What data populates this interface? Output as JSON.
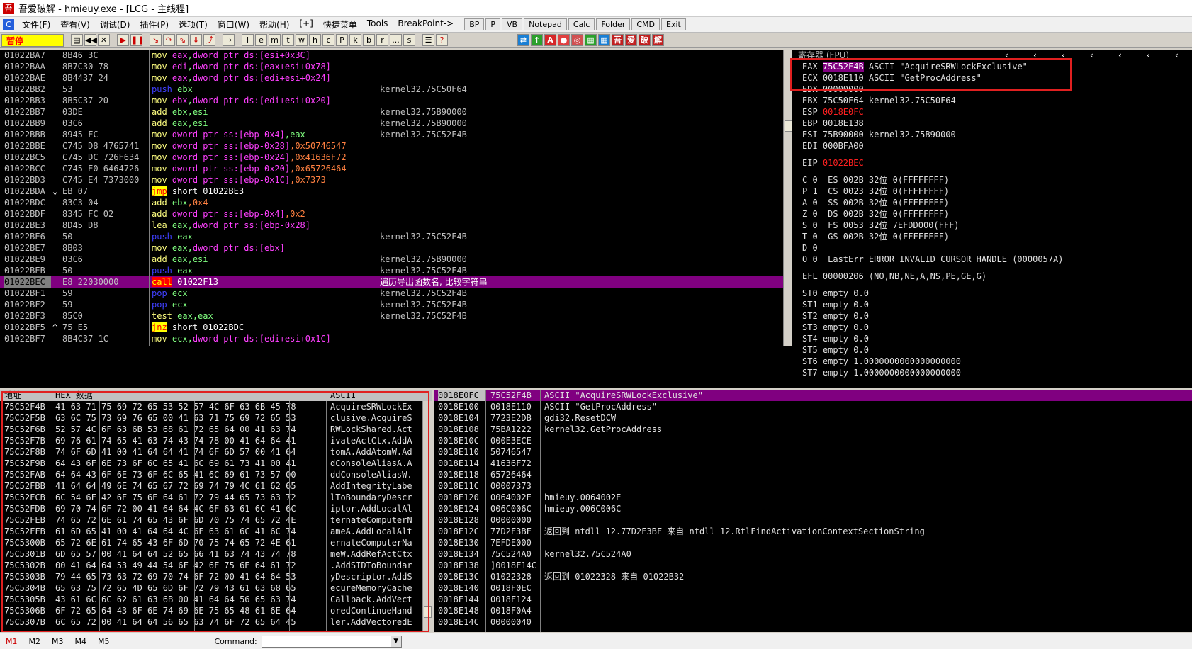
{
  "window": {
    "title": "吾爱破解 - hmieuy.exe - [LCG - 主线程]"
  },
  "menu": {
    "items": [
      "文件(F)",
      "查看(V)",
      "调试(D)",
      "插件(P)",
      "选项(T)",
      "窗口(W)",
      "帮助(H)",
      "[+]",
      "快捷菜单",
      "Tools",
      "BreakPoint->"
    ],
    "buttons": [
      "BP",
      "P",
      "VB",
      "Notepad",
      "Calc",
      "Folder",
      "CMD",
      "Exit"
    ]
  },
  "toolbar": {
    "status": "暂停",
    "letters": [
      "l",
      "e",
      "m",
      "t",
      "w",
      "h",
      "c",
      "P",
      "k",
      "b",
      "r",
      "...",
      "s"
    ]
  },
  "disasm": {
    "selected_index": 20,
    "rows": [
      {
        "addr": "01022BA7",
        "mark": "",
        "hex": "8B46 3C",
        "op": "mov",
        "args": [
          [
            "reg",
            "eax"
          ],
          [
            "",
            ","
          ],
          [
            "reg",
            "dword ptr ds:[esi+0x3C]"
          ]
        ],
        "cmt": ""
      },
      {
        "addr": "01022BAA",
        "mark": "",
        "hex": "8B7C30 78",
        "op": "mov",
        "args": [
          [
            "reg",
            "edi"
          ],
          [
            "",
            ","
          ],
          [
            "reg",
            "dword ptr ds:[eax+esi+0x78]"
          ]
        ],
        "cmt": ""
      },
      {
        "addr": "01022BAE",
        "mark": "",
        "hex": "8B4437 24",
        "op": "mov",
        "args": [
          [
            "reg",
            "eax"
          ],
          [
            "",
            ","
          ],
          [
            "reg",
            "dword ptr ds:[edi+esi+0x24]"
          ]
        ],
        "cmt": ""
      },
      {
        "addr": "01022BB2",
        "mark": "",
        "hex": "53",
        "op": "push",
        "args": [
          [
            "green",
            "ebx"
          ]
        ],
        "cmt": "kernel32.75C50F64"
      },
      {
        "addr": "01022BB3",
        "mark": "",
        "hex": "8B5C37 20",
        "op": "mov",
        "args": [
          [
            "reg",
            "ebx"
          ],
          [
            "",
            ","
          ],
          [
            "reg",
            "dword ptr ds:[edi+esi+0x20]"
          ]
        ],
        "cmt": ""
      },
      {
        "addr": "01022BB7",
        "mark": "",
        "hex": "03DE",
        "op": "add",
        "args": [
          [
            "green",
            "ebx,esi"
          ]
        ],
        "cmt": "kernel32.75B90000"
      },
      {
        "addr": "01022BB9",
        "mark": "",
        "hex": "03C6",
        "op": "add",
        "args": [
          [
            "green",
            "eax,esi"
          ]
        ],
        "cmt": "kernel32.75B90000"
      },
      {
        "addr": "01022BBB",
        "mark": "",
        "hex": "8945 FC",
        "op": "mov",
        "args": [
          [
            "reg",
            "dword ptr ss:[ebp-0x4]"
          ],
          [
            "green",
            ",eax"
          ]
        ],
        "cmt": "kernel32.75C52F4B"
      },
      {
        "addr": "01022BBE",
        "mark": "",
        "hex": "C745 D8 4765741",
        "op": "mov",
        "args": [
          [
            "reg",
            "dword ptr ss:[ebp-0x28]"
          ],
          [
            "imm",
            ",0x50746547"
          ]
        ],
        "cmt": ""
      },
      {
        "addr": "01022BC5",
        "mark": "",
        "hex": "C745 DC 726F634",
        "op": "mov",
        "args": [
          [
            "reg",
            "dword ptr ss:[ebp-0x24]"
          ],
          [
            "imm",
            ",0x41636F72"
          ]
        ],
        "cmt": ""
      },
      {
        "addr": "01022BCC",
        "mark": "",
        "hex": "C745 E0 6464726",
        "op": "mov",
        "args": [
          [
            "reg",
            "dword ptr ss:[ebp-0x20]"
          ],
          [
            "imm",
            ",0x65726464"
          ]
        ],
        "cmt": ""
      },
      {
        "addr": "01022BD3",
        "mark": "",
        "hex": "C745 E4 7373000",
        "op": "mov",
        "args": [
          [
            "reg",
            "dword ptr ss:[ebp-0x1C]"
          ],
          [
            "imm",
            ",0x7373"
          ]
        ],
        "cmt": ""
      },
      {
        "addr": "01022BDA",
        "mark": "⌄",
        "hex": "EB 07",
        "op": "jmp",
        "args": [
          [
            "white",
            "short 01022BE3"
          ]
        ],
        "cmt": ""
      },
      {
        "addr": "01022BDC",
        "mark": "",
        "hex": "83C3 04",
        "op": "add",
        "args": [
          [
            "green",
            "ebx"
          ],
          [
            "imm",
            ",0x4"
          ]
        ],
        "cmt": ""
      },
      {
        "addr": "01022BDF",
        "mark": "",
        "hex": "8345 FC 02",
        "op": "add",
        "args": [
          [
            "reg",
            "dword ptr ss:[ebp-0x4]"
          ],
          [
            "imm",
            ",0x2"
          ]
        ],
        "cmt": ""
      },
      {
        "addr": "01022BE3",
        "mark": "",
        "hex": "8D45 D8",
        "op": "lea",
        "args": [
          [
            "green",
            "eax"
          ],
          [
            "",
            ","
          ],
          [
            "reg",
            "dword ptr ss:[ebp-0x28]"
          ]
        ],
        "cmt": ""
      },
      {
        "addr": "01022BE6",
        "mark": "",
        "hex": "50",
        "op": "push",
        "args": [
          [
            "green",
            "eax"
          ]
        ],
        "cmt": "kernel32.75C52F4B"
      },
      {
        "addr": "01022BE7",
        "mark": "",
        "hex": "8B03",
        "op": "mov",
        "args": [
          [
            "green",
            "eax"
          ],
          [
            "",
            ","
          ],
          [
            "reg",
            "dword ptr ds:[ebx]"
          ]
        ],
        "cmt": ""
      },
      {
        "addr": "01022BE9",
        "mark": "",
        "hex": "03C6",
        "op": "add",
        "args": [
          [
            "green",
            "eax,esi"
          ]
        ],
        "cmt": "kernel32.75B90000"
      },
      {
        "addr": "01022BEB",
        "mark": "",
        "hex": "50",
        "op": "push",
        "args": [
          [
            "green",
            "eax"
          ]
        ],
        "cmt": "kernel32.75C52F4B"
      },
      {
        "addr": "01022BEC",
        "mark": "",
        "hex": "E8 22030000",
        "op": "call",
        "args": [
          [
            "white",
            "01022F13"
          ]
        ],
        "cmt": "遍历导出函数名, 比较字符串"
      },
      {
        "addr": "01022BF1",
        "mark": "",
        "hex": "59",
        "op": "pop",
        "args": [
          [
            "green",
            "ecx"
          ]
        ],
        "cmt": "kernel32.75C52F4B"
      },
      {
        "addr": "01022BF2",
        "mark": "",
        "hex": "59",
        "op": "pop",
        "args": [
          [
            "green",
            "ecx"
          ]
        ],
        "cmt": "kernel32.75C52F4B"
      },
      {
        "addr": "01022BF3",
        "mark": "",
        "hex": "85C0",
        "op": "test",
        "args": [
          [
            "green",
            "eax,eax"
          ]
        ],
        "cmt": "kernel32.75C52F4B"
      },
      {
        "addr": "01022BF5",
        "mark": "^",
        "hex": "75 E5",
        "op": "jnz",
        "args": [
          [
            "white",
            "short 01022BDC"
          ]
        ],
        "cmt": ""
      },
      {
        "addr": "01022BF7",
        "mark": "",
        "hex": "8B4C37 1C",
        "op": "mov",
        "args": [
          [
            "green",
            "ecx"
          ],
          [
            "",
            ","
          ],
          [
            "reg",
            "dword ptr ds:[edi+esi+0x1C]"
          ]
        ],
        "cmt": ""
      }
    ]
  },
  "registers": {
    "header": "寄存器 (FPU)",
    "lines": [
      [
        [
          "w",
          "EAX "
        ],
        [
          "selbg",
          "75C52F4B"
        ],
        [
          "w",
          " ASCII \"AcquireSRWLockExclusive\""
        ]
      ],
      [
        [
          "w",
          "ECX 0018E110 ASCII \"GetProcAddress\""
        ]
      ],
      [
        [
          "w",
          "EDX 00000000"
        ]
      ],
      [
        [
          "w",
          "EBX 75C50F64 kernel32.75C50F64"
        ]
      ],
      [
        [
          "w",
          "ESP "
        ],
        [
          "r",
          "0018E0FC"
        ]
      ],
      [
        [
          "w",
          "EBP 0018E138"
        ]
      ],
      [
        [
          "w",
          "ESI 75B90000 kernel32.75B90000"
        ]
      ],
      [
        [
          "w",
          "EDI 000BFA00"
        ]
      ],
      [
        [
          "w",
          ""
        ]
      ],
      [
        [
          "w",
          "EIP "
        ],
        [
          "r",
          "01022BEC"
        ]
      ],
      [
        [
          "w",
          ""
        ]
      ],
      [
        [
          "w",
          "C 0  ES 002B 32位 0(FFFFFFFF)"
        ]
      ],
      [
        [
          "w",
          "P 1  CS 0023 32位 0(FFFFFFFF)"
        ]
      ],
      [
        [
          "w",
          "A 0  SS 002B 32位 0(FFFFFFFF)"
        ]
      ],
      [
        [
          "w",
          "Z 0  DS 002B 32位 0(FFFFFFFF)"
        ]
      ],
      [
        [
          "w",
          "S 0  FS 0053 32位 7EFDD000(FFF)"
        ]
      ],
      [
        [
          "w",
          "T 0  GS 002B 32位 0(FFFFFFFF)"
        ]
      ],
      [
        [
          "w",
          "D 0"
        ]
      ],
      [
        [
          "w",
          "O 0  LastErr ERROR_INVALID_CURSOR_HANDLE (0000057A)"
        ]
      ],
      [
        [
          "w",
          ""
        ]
      ],
      [
        [
          "w",
          "EFL 00000206 (NO,NB,NE,A,NS,PE,GE,G)"
        ]
      ],
      [
        [
          "w",
          ""
        ]
      ],
      [
        [
          "w",
          "ST0 empty 0.0"
        ]
      ],
      [
        [
          "w",
          "ST1 empty 0.0"
        ]
      ],
      [
        [
          "w",
          "ST2 empty 0.0"
        ]
      ],
      [
        [
          "w",
          "ST3 empty 0.0"
        ]
      ],
      [
        [
          "w",
          "ST4 empty 0.0"
        ]
      ],
      [
        [
          "w",
          "ST5 empty 0.0"
        ]
      ],
      [
        [
          "w",
          "ST6 empty 1.0000000000000000000"
        ]
      ],
      [
        [
          "w",
          "ST7 empty 1.0000000000000000000"
        ]
      ]
    ]
  },
  "dump": {
    "headers": [
      "地址",
      "HEX 数据",
      "ASCII"
    ],
    "rows": [
      [
        "75C52F4B",
        "41 63 71 75 69 72 65 53 52 57 4C 6F 63 6B 45 78",
        "AcquireSRWLockEx"
      ],
      [
        "75C52F5B",
        "63 6C 75 73 69 76 65 00 41 63 71 75 69 72 65 53",
        "clusive.AcquireS"
      ],
      [
        "75C52F6B",
        "52 57 4C 6F 63 6B 53 68 61 72 65 64 00 41 63 74",
        "RWLockShared.Act"
      ],
      [
        "75C52F7B",
        "69 76 61 74 65 41 63 74 43 74 78 00 41 64 64 41",
        "ivateActCtx.AddA"
      ],
      [
        "75C52F8B",
        "74 6F 6D 41 00 41 64 64 41 74 6F 6D 57 00 41 64",
        "tomA.AddAtomW.Ad"
      ],
      [
        "75C52F9B",
        "64 43 6F 6E 73 6F 6C 65 41 6C 69 61 73 41 00 41",
        "dConsoleAliasA.A"
      ],
      [
        "75C52FAB",
        "64 64 43 6F 6E 73 6F 6C 65 41 6C 69 61 73 57 00",
        "ddConsoleAliasW."
      ],
      [
        "75C52FBB",
        "41 64 64 49 6E 74 65 67 72 69 74 79 4C 61 62 65",
        "AddIntegrityLabe"
      ],
      [
        "75C52FCB",
        "6C 54 6F 42 6F 75 6E 64 61 72 79 44 65 73 63 72",
        "lToBoundaryDescr"
      ],
      [
        "75C52FDB",
        "69 70 74 6F 72 00 41 64 64 4C 6F 63 61 6C 41 6C",
        "iptor.AddLocalAl"
      ],
      [
        "75C52FEB",
        "74 65 72 6E 61 74 65 43 6F 6D 70 75 74 65 72 4E",
        "ternateComputerN"
      ],
      [
        "75C52FFB",
        "61 6D 65 41 00 41 64 64 4C 6F 63 61 6C 41 6C 74",
        "ameA.AddLocalAlt"
      ],
      [
        "75C5300B",
        "65 72 6E 61 74 65 43 6F 6D 70 75 74 65 72 4E 61",
        "ernateComputerNa"
      ],
      [
        "75C5301B",
        "6D 65 57 00 41 64 64 52 65 66 41 63 74 43 74 78",
        "meW.AddRefActCtx"
      ],
      [
        "75C5302B",
        "00 41 64 64 53 49 44 54 6F 42 6F 75 6E 64 61 72",
        ".AddSIDToBoundar"
      ],
      [
        "75C5303B",
        "79 44 65 73 63 72 69 70 74 6F 72 00 41 64 64 53",
        "yDescriptor.AddS"
      ],
      [
        "75C5304B",
        "65 63 75 72 65 4D 65 6D 6F 72 79 43 61 63 68 65",
        "ecureMemoryCache"
      ],
      [
        "75C5305B",
        "43 61 6C 6C 62 61 63 6B 00 41 64 64 56 65 63 74",
        "Callback.AddVect"
      ],
      [
        "75C5306B",
        "6F 72 65 64 43 6F 6E 74 69 6E 75 65 48 61 6E 64",
        "oredContinueHand"
      ],
      [
        "75C5307B",
        "6C 65 72 00 41 64 64 56 65 63 74 6F 72 65 64 45",
        "ler.AddVectoredE"
      ]
    ]
  },
  "stack": {
    "rows": [
      [
        "0018E0FC",
        "75C52F4B",
        "ASCII \"AcquireSRWLockExclusive\""
      ],
      [
        "0018E100",
        "0018E110",
        "ASCII \"GetProcAddress\""
      ],
      [
        "0018E104",
        "7723E2DB",
        "gdi32.ResetDCW"
      ],
      [
        "0018E108",
        "75BA1222",
        "kernel32.GetProcAddress"
      ],
      [
        "0018E10C",
        "000E3ECE",
        ""
      ],
      [
        "0018E110",
        "50746547",
        ""
      ],
      [
        "0018E114",
        "41636F72",
        ""
      ],
      [
        "0018E118",
        "65726464",
        ""
      ],
      [
        "0018E11C",
        "00007373",
        ""
      ],
      [
        "0018E120",
        "0064002E",
        "hmieuy.0064002E"
      ],
      [
        "0018E124",
        "006C006C",
        "hmieuy.006C006C"
      ],
      [
        "0018E128",
        "00000000",
        ""
      ],
      [
        "0018E12C",
        "77D2F3BF",
        "返回到 ntdll_12.77D2F3BF 来自 ntdll_12.RtlFindActivationContextSectionString"
      ],
      [
        "0018E130",
        "7EFDE000",
        ""
      ],
      [
        "0018E134",
        "75C524A0",
        "kernel32.75C524A0"
      ],
      [
        "0018E138",
        "]0018F14C",
        ""
      ],
      [
        "0018E13C",
        "01022328",
        "返回到 01022328 来自 01022B32"
      ],
      [
        "0018E140",
        "0018F0EC",
        ""
      ],
      [
        "0018E144",
        "0018F124",
        ""
      ],
      [
        "0018E148",
        "0018F0A4",
        ""
      ],
      [
        "0018E14C",
        "00000040",
        ""
      ]
    ]
  },
  "bottom": {
    "tabs": [
      "M1",
      "M2",
      "M3",
      "M4",
      "M5"
    ],
    "command_label": "Command:"
  }
}
